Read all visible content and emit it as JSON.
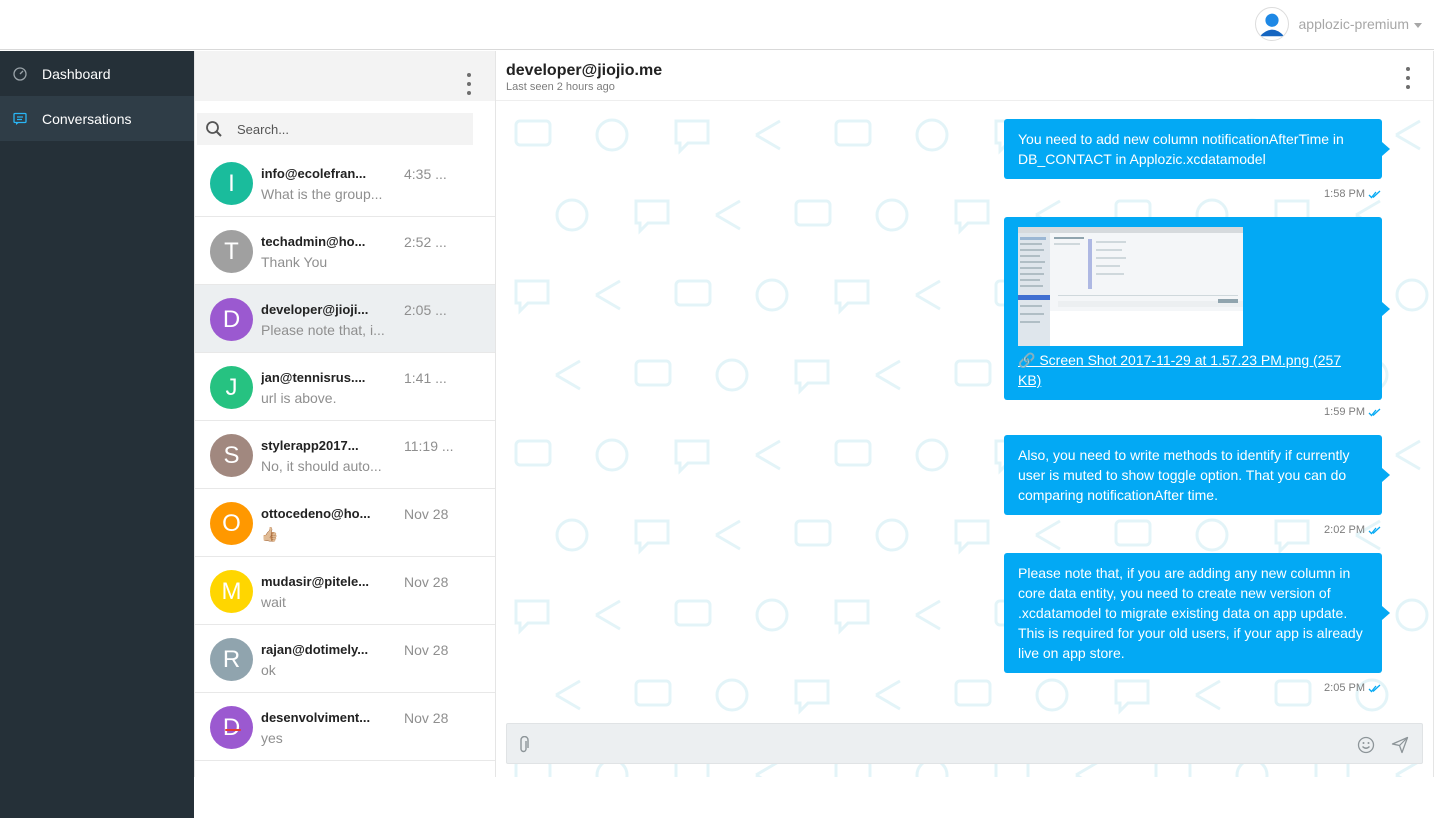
{
  "header": {
    "account_name": "applozic-premium"
  },
  "sidebar": {
    "items": [
      {
        "label": "Dashboard",
        "icon": "dashboard-icon"
      },
      {
        "label": "Conversations",
        "icon": "chat-icon",
        "active": true
      }
    ]
  },
  "conversation_list": {
    "search_placeholder": "Search...",
    "items": [
      {
        "initial": "I",
        "color": "#1abc9c",
        "name": "info@ecolefran...",
        "preview": "What is the group...",
        "time": "4:35 ..."
      },
      {
        "initial": "T",
        "color": "#a0a0a0",
        "name": "techadmin@ho...",
        "preview": "Thank You",
        "time": "2:52 ..."
      },
      {
        "initial": "D",
        "color": "#9b59d0",
        "name": "developer@jioji...",
        "preview": "Please note that, i...",
        "time": "2:05 ...",
        "active": true
      },
      {
        "initial": "J",
        "color": "#26c281",
        "name": "jan@tennisrus....",
        "preview": "url is above.",
        "time": "1:41 ..."
      },
      {
        "initial": "S",
        "color": "#a1887f",
        "name": "stylerapp2017...",
        "preview": "No, it should auto...",
        "time": "11:19 ..."
      },
      {
        "initial": "O",
        "color": "#ff9800",
        "name": "ottocedeno@ho...",
        "preview": "👍🏼",
        "time": "Nov 28"
      },
      {
        "initial": "M",
        "color": "#ffd600",
        "name": "mudasir@pitele...",
        "preview": "wait",
        "time": "Nov 28"
      },
      {
        "initial": "R",
        "color": "#90a4ae",
        "name": "rajan@dotimely...",
        "preview": "ok",
        "time": "Nov 28"
      },
      {
        "initial": "D",
        "color": "#9b59d0",
        "name": "desenvolviment...",
        "preview": "yes",
        "time": "Nov 28"
      }
    ]
  },
  "chat": {
    "title": "developer@jiojio.me",
    "status": "Last seen 2 hours ago",
    "messages": [
      {
        "text": "You need to add new column notificationAfterTime  in  DB_CONTACT in Applozic.xcdatamodel",
        "time": "1:58 PM"
      },
      {
        "attachment": "🔗 Screen Shot 2017-11-29 at 1.57.23 PM.png (257 KB)",
        "time": "1:59 PM"
      },
      {
        "text": "Also, you need to write methods to identify if currently user is muted to show toggle option. That you can do comparing notificationAfter time.",
        "time": "2:02 PM"
      },
      {
        "text": "Please note that, if you are adding any new column in core data entity, you need to create new version of .xcdatamodel to migrate existing  data on app update. This is required for your old users, if your app is already live on app store.",
        "time": "2:05 PM"
      }
    ],
    "composer_placeholder": ""
  },
  "colors": {
    "sidebar_bg": "#253038",
    "bubble": "#03a9f4",
    "tick": "#03a9f4"
  }
}
